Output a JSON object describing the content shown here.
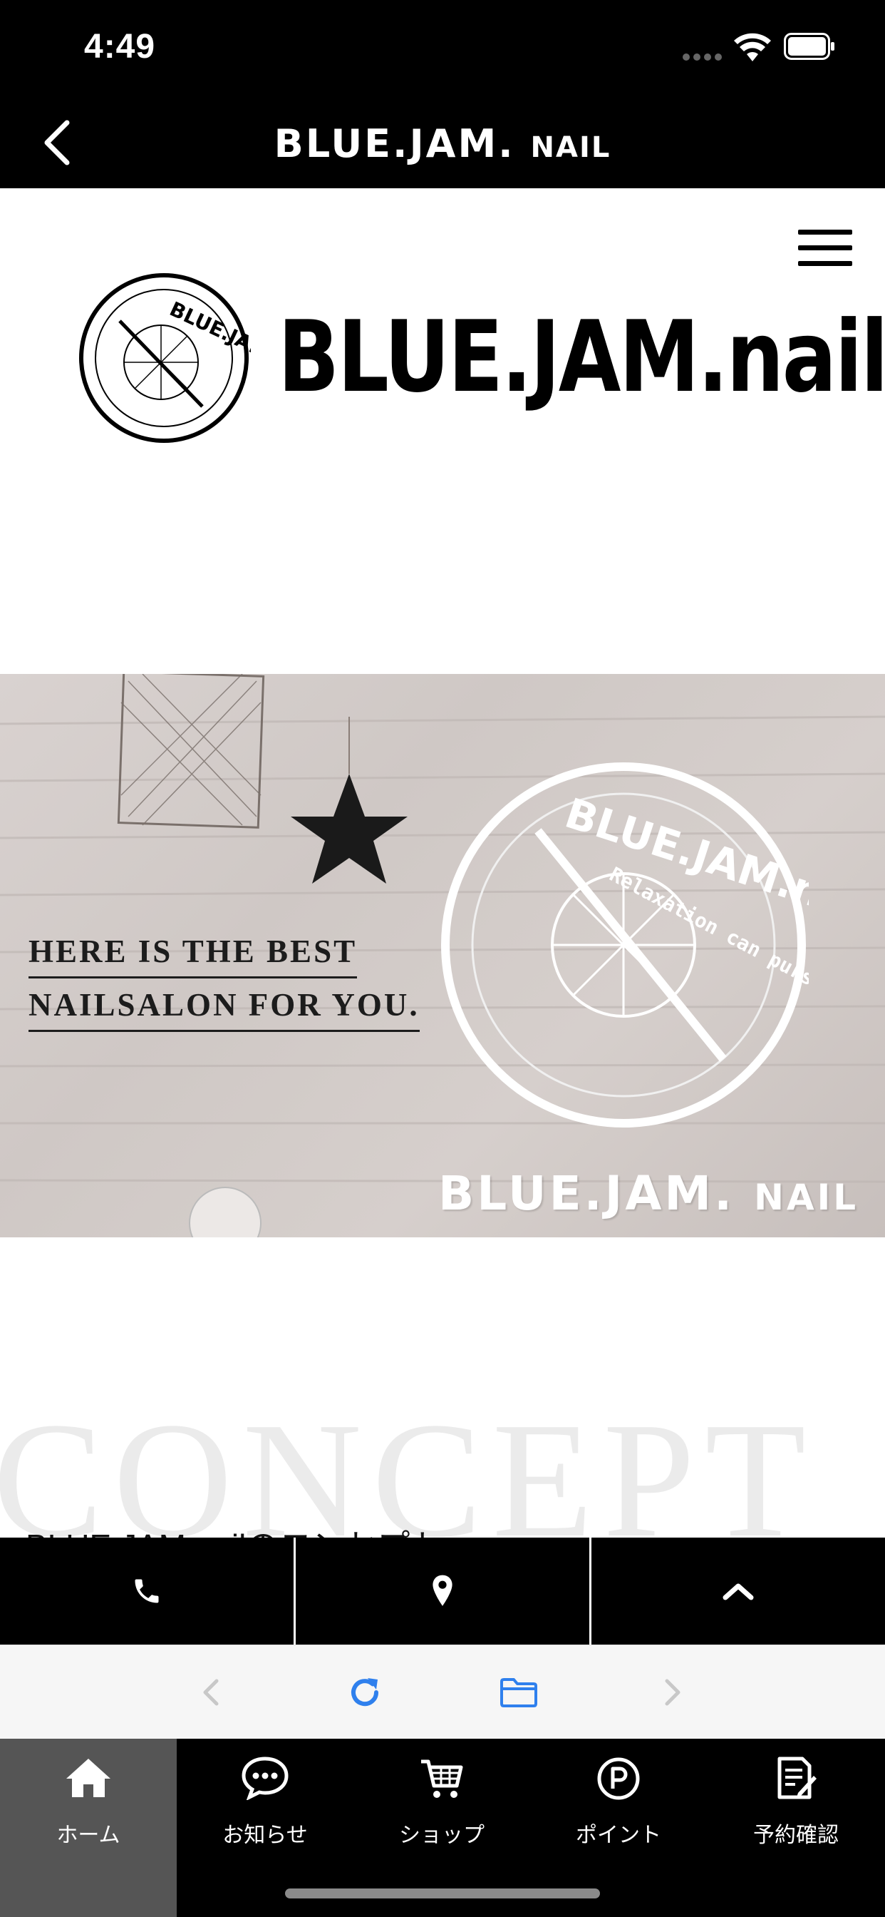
{
  "status_bar": {
    "time": "4:49"
  },
  "nav": {
    "title_main": "BLUE.JAM.",
    "title_small": "NAIL"
  },
  "brand": {
    "wordmark": "BLUE.JAM.nail",
    "badge_text": "BLUE.JAM.nail"
  },
  "hero": {
    "line1": "HERE IS THE BEST",
    "line2": "NAILSALON FOR YOU.",
    "sign_main": "BLUE.JAM.",
    "sign_small": "NAIL",
    "sign_ring_top": "BLUE.JAM.nail",
    "sign_ring_inner": "Relaxation can pursue the beauty of all"
  },
  "concept": {
    "bg_word": "CONCEPT",
    "heading": "BLUE.JAM.nailのコンセプト"
  },
  "action_bar": {
    "icons": [
      "phone-icon",
      "map-pin-icon",
      "chevron-up-icon"
    ]
  },
  "browser_bar": {
    "icons": [
      "back-arrow-icon",
      "reload-icon",
      "folder-icon",
      "forward-arrow-icon"
    ]
  },
  "tabs": [
    {
      "label": "ホーム",
      "icon": "home-icon",
      "active": true
    },
    {
      "label": "お知らせ",
      "icon": "chat-bubble-icon",
      "active": false
    },
    {
      "label": "ショップ",
      "icon": "cart-icon",
      "active": false
    },
    {
      "label": "ポイント",
      "icon": "point-icon",
      "active": false
    },
    {
      "label": "予約確認",
      "icon": "reservation-icon",
      "active": false
    }
  ],
  "colors": {
    "bar_bg": "#000000",
    "active_tab": "#555555",
    "browser_icon": "#2f80ed",
    "concept_bg_text": "#ebebeb"
  }
}
